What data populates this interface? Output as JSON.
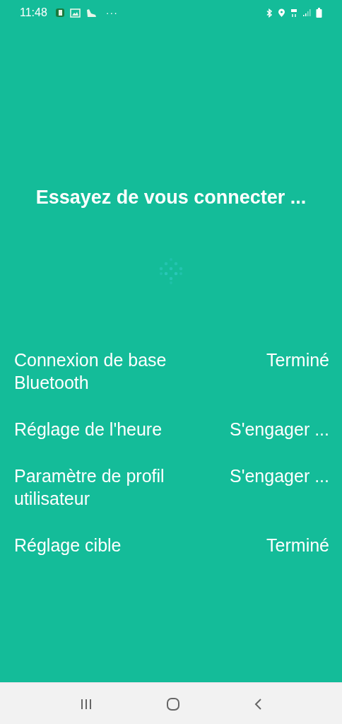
{
  "status_bar": {
    "time": "11:48",
    "more": "···"
  },
  "title": "Essayez de vous connecter ...",
  "steps": [
    {
      "label": "Connexion de base Bluetooth",
      "status": "Terminé"
    },
    {
      "label": "Réglage de l'heure",
      "status": "S'engager ..."
    },
    {
      "label": "Paramètre de profil utilisateur",
      "status": "S'engager ..."
    },
    {
      "label": "Réglage cible",
      "status": "Terminé"
    }
  ]
}
